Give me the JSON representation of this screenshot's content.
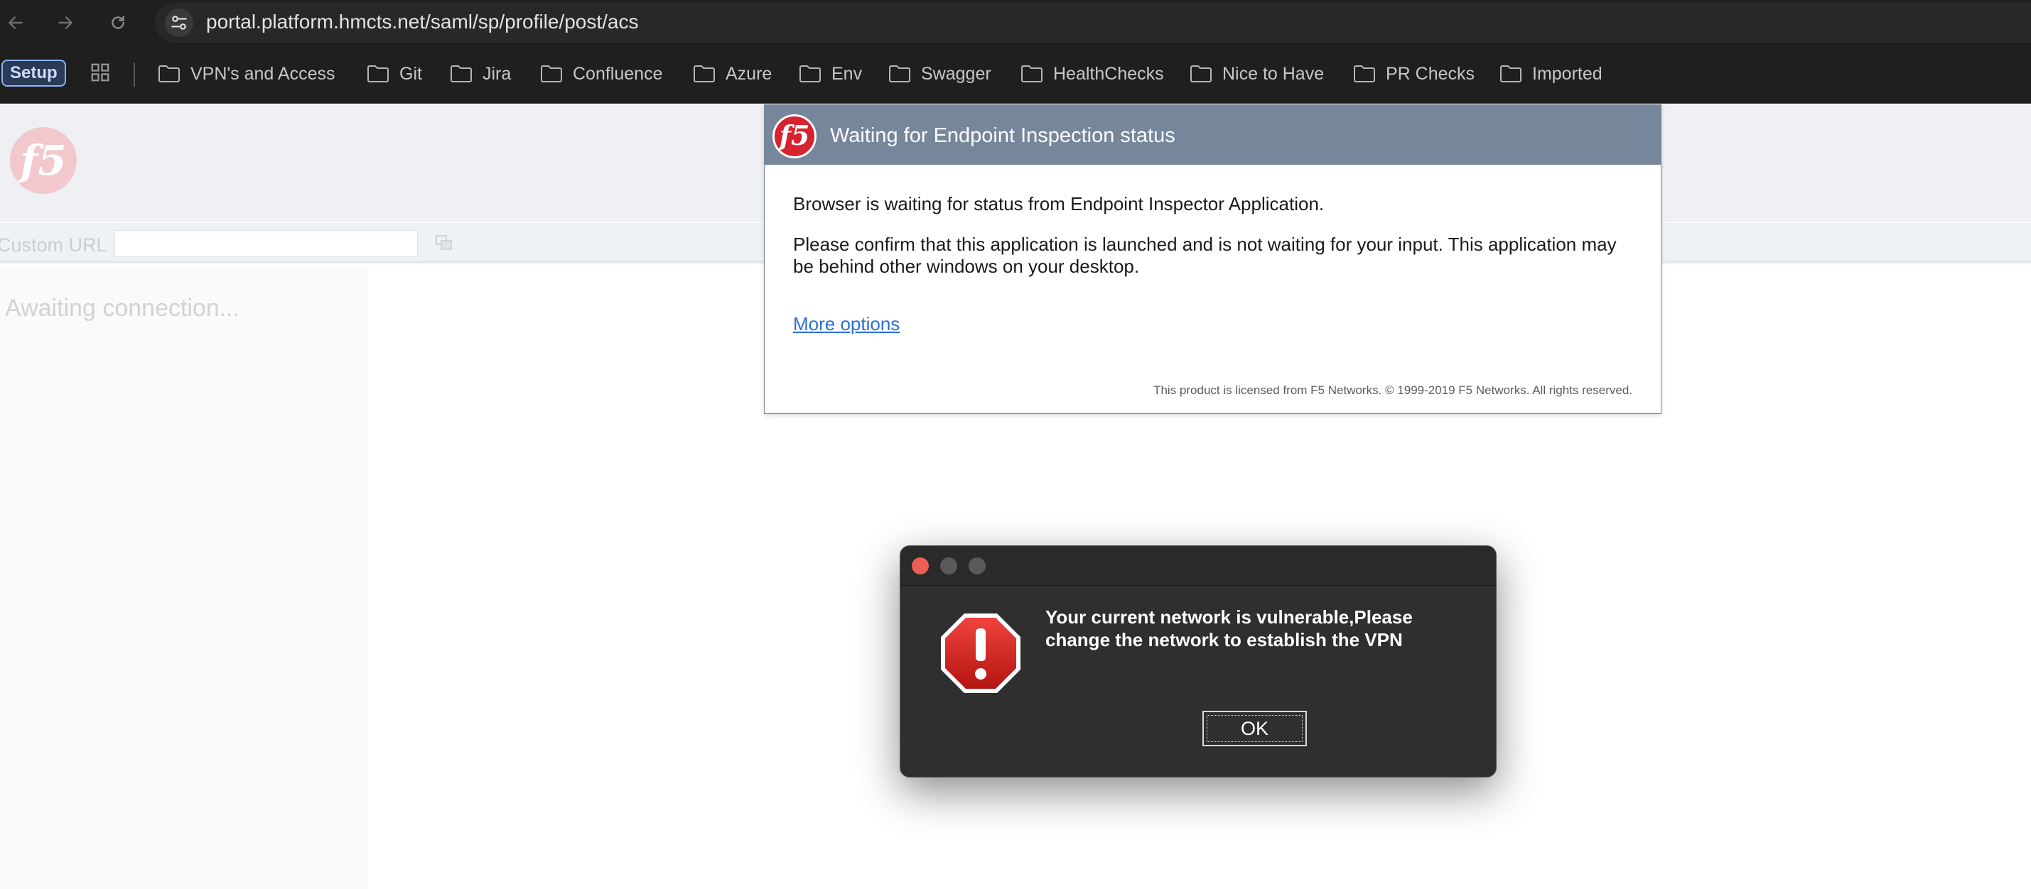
{
  "browser": {
    "url": "portal.platform.hmcts.net/saml/sp/profile/post/acs",
    "bookmarks_bar": {
      "setup_label": "Setup",
      "folders": [
        "VPN's and Access",
        "Git",
        "Jira",
        "Confluence",
        "Azure",
        "Env",
        "Swagger",
        "HealthChecks",
        "Nice to Have",
        "PR Checks",
        "Imported"
      ]
    }
  },
  "page": {
    "logo_text": "f5",
    "custom_url_label": "Custom URL",
    "custom_url_value": "",
    "status_text": "Awaiting connection..."
  },
  "endpoint_dialog": {
    "logo_text": "f5",
    "title": "Waiting for Endpoint Inspection status",
    "body_line1": "Browser is waiting for status from Endpoint Inspector Application.",
    "body_line2": "Please confirm that this application is launched and is not waiting for your input. This application may be behind other windows on your desktop.",
    "more_options_link": "More options",
    "footer": "This product is licensed from F5 Networks. © 1999-2019 F5 Networks. All rights reserved."
  },
  "alert": {
    "icon": "stop-warning-icon",
    "message": "Your current network is vulnerable,Please change the network to establish the VPN",
    "ok_label": "OK"
  },
  "colors": {
    "chrome_bg": "#1f1f1f",
    "dialog_header": "#76869b",
    "link": "#2a6fd6",
    "f5_red": "#d7222f",
    "alert_bg": "#2f2f2f"
  }
}
